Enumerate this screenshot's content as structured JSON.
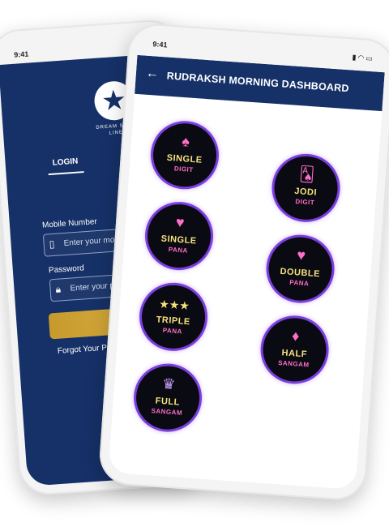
{
  "login_phone": {
    "time": "9:41",
    "logo_text_line1": "DREAM STAR",
    "logo_text_line2": "LINE",
    "tab_login": "LOGIN",
    "mobile_label": "Mobile Number",
    "mobile_placeholder": "Enter your mobile",
    "password_label": "Password",
    "password_placeholder": "Enter your pass",
    "forgot_text": "Forgot Your Pass"
  },
  "dashboard_phone": {
    "time": "9:41",
    "title": "RUDRAKSH MORNING DASHBOARD",
    "games": [
      {
        "line1": "SINGLE",
        "line2": "DIGIT",
        "icon": "♠"
      },
      {
        "line1": "JODI",
        "line2": "DIGIT",
        "icon": "🂡"
      },
      {
        "line1": "SINGLE",
        "line2": "PANA",
        "icon": "♥"
      },
      {
        "line1": "DOUBLE",
        "line2": "PANA",
        "icon": "♥"
      },
      {
        "line1": "TRIPLE",
        "line2": "PANA",
        "icon": "★★★"
      },
      {
        "line1": "HALF",
        "line2": "SANGAM",
        "icon": "♦"
      },
      {
        "line1": "FULL",
        "line2": "SANGAM",
        "icon": "♛"
      }
    ]
  },
  "colors": {
    "navy": "#163168",
    "gold": "#d4aa3a",
    "neon_purple": "#7b3fe0"
  }
}
